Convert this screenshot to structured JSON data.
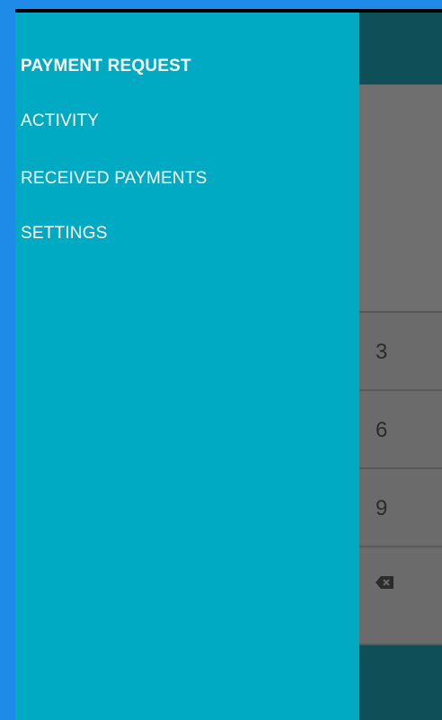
{
  "drawer": {
    "items": [
      {
        "label": "PAYMENT REQUEST",
        "active": true
      },
      {
        "label": "ACTIVITY",
        "active": false
      },
      {
        "label": "RECEIVED PAYMENTS",
        "active": false
      },
      {
        "label": "SETTINGS",
        "active": false
      }
    ]
  },
  "keypad": {
    "keys": [
      "3",
      "6",
      "9"
    ],
    "backspace_icon": "backspace-icon"
  },
  "colors": {
    "drawer_background": "#00aac2",
    "toolbar_background": "#0f4f57",
    "scrim_background": "#6f6f6f",
    "frame_border": "#1e8be8"
  }
}
